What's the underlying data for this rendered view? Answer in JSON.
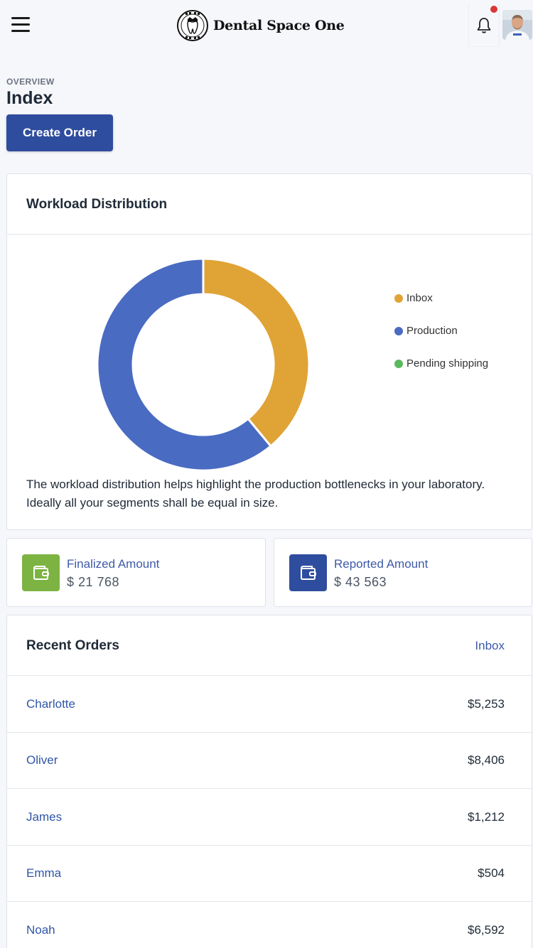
{
  "header": {
    "brand": "Dental Space One",
    "notification_badge": true
  },
  "page": {
    "section_label": "OVERVIEW",
    "title": "Index",
    "create_button": "Create Order"
  },
  "workload": {
    "title": "Workload Distribution",
    "description": "The workload distribution helps highlight the production bottlenecks in your laboratory. Ideally all your segments shall be equal in size.",
    "legend": [
      {
        "label": "Inbox",
        "color": "#e0a335"
      },
      {
        "label": "Production",
        "color": "#4a6bc2"
      },
      {
        "label": "Pending shipping",
        "color": "#5cb85c"
      }
    ]
  },
  "chart_data": {
    "type": "pie",
    "title": "",
    "categories": [
      "Inbox",
      "Production",
      "Pending shipping"
    ],
    "values": [
      39,
      61,
      0
    ],
    "colors": [
      "#e0a335",
      "#4a6bc2",
      "#5cb85c"
    ],
    "donut": true,
    "legend_position": "right"
  },
  "stats": {
    "finalized": {
      "label": "Finalized Amount",
      "value": "$ 21 768",
      "icon": "wallet-icon",
      "color": "#7cb342"
    },
    "reported": {
      "label": "Reported Amount",
      "value": "$ 43 563",
      "icon": "wallet-icon",
      "color": "#2f4d9e"
    }
  },
  "orders": {
    "title": "Recent Orders",
    "link": "Inbox",
    "rows": [
      {
        "name": "Charlotte",
        "amount": "$5,253"
      },
      {
        "name": "Oliver",
        "amount": "$8,406"
      },
      {
        "name": "James",
        "amount": "$1,212"
      },
      {
        "name": "Emma",
        "amount": "$504"
      },
      {
        "name": "Noah",
        "amount": "$6,592"
      }
    ]
  }
}
